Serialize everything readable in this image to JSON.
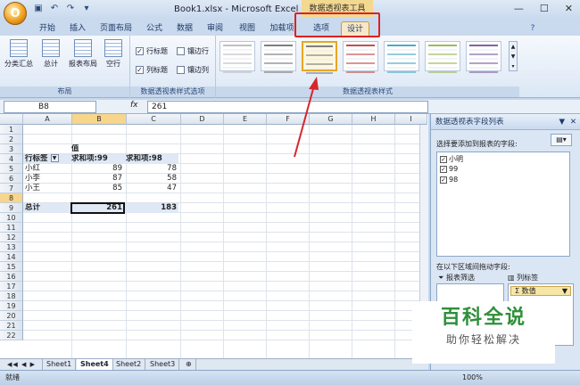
{
  "title_bar": {
    "window_title": "Book1.xlsx - Microsoft Excel",
    "context_tool_title": "数据透视表工具",
    "office_button_glyph": "O",
    "qat_icons": [
      "save-icon",
      "undo-icon",
      "redo-icon",
      "customize-icon"
    ],
    "window_controls": [
      "minimize-icon",
      "maximize-icon",
      "close-icon"
    ]
  },
  "ribbon_tabs": [
    {
      "label": "开始"
    },
    {
      "label": "插入"
    },
    {
      "label": "页面布局"
    },
    {
      "label": "公式"
    },
    {
      "label": "数据"
    },
    {
      "label": "审阅"
    },
    {
      "label": "视图"
    },
    {
      "label": "加载项"
    },
    {
      "label": "选项"
    },
    {
      "label": "设计"
    }
  ],
  "ribbon": {
    "layout_group": {
      "label": "布局",
      "buttons": [
        "分类汇总",
        "总计",
        "报表布局",
        "空行"
      ]
    },
    "style_options_group": {
      "label": "数据透视表样式选项",
      "checks": [
        {
          "label": "行标题",
          "checked": true
        },
        {
          "label": "镶边行",
          "checked": false
        },
        {
          "label": "列标题",
          "checked": true
        },
        {
          "label": "镶边列",
          "checked": false
        }
      ]
    },
    "styles_group": {
      "label": "数据透视表样式",
      "accent_selected": "#e8a527",
      "thumb_palettes": [
        "#c0c0c0",
        "#7f7f7f",
        "#7f7f7f",
        "#c0504d",
        "#4bacc6",
        "#9bbb59",
        "#8064a2"
      ]
    }
  },
  "formula_bar": {
    "name_box": "B8",
    "fx_label": "fx",
    "value": "261"
  },
  "sheet": {
    "columns": [
      "A",
      "B",
      "C",
      "D",
      "E",
      "F",
      "G",
      "H",
      "I"
    ],
    "rows": [
      "1",
      "2",
      "3",
      "4",
      "5",
      "6",
      "7",
      "8",
      "9",
      "10",
      "11",
      "12",
      "13",
      "14",
      "15",
      "16",
      "17",
      "18",
      "19",
      "20",
      "21",
      "22"
    ],
    "pivot": {
      "value_header": "值",
      "row_label_header": "行标签",
      "col1_header": "求和项:99",
      "col2_header": "求和项:98",
      "rows": [
        {
          "name": "小红",
          "v1": "89",
          "v2": "78"
        },
        {
          "name": "小李",
          "v1": "87",
          "v2": "58"
        },
        {
          "name": "小王",
          "v1": "85",
          "v2": "47"
        }
      ],
      "total": {
        "name": "总计",
        "v1": "261",
        "v2": "183"
      }
    },
    "tabs": [
      "Sheet1",
      "Sheet4",
      "Sheet2",
      "Sheet3"
    ],
    "active_tab": "Sheet4"
  },
  "status": {
    "ready": "就绪",
    "zoom": "100%"
  },
  "field_panel": {
    "title": "数据透视表字段列表",
    "choose_label": "选择要添加到报表的字段:",
    "fields": [
      {
        "name": "小明",
        "checked": true
      },
      {
        "name": "99",
        "checked": true
      },
      {
        "name": "98",
        "checked": true
      }
    ],
    "drag_label": "在以下区域间拖动字段:",
    "report_filter": "报表筛选",
    "column_labels": "列标签",
    "values_chip": "数值"
  },
  "watermark": {
    "line1": "百科全说",
    "line2": "助你轻松解决"
  }
}
